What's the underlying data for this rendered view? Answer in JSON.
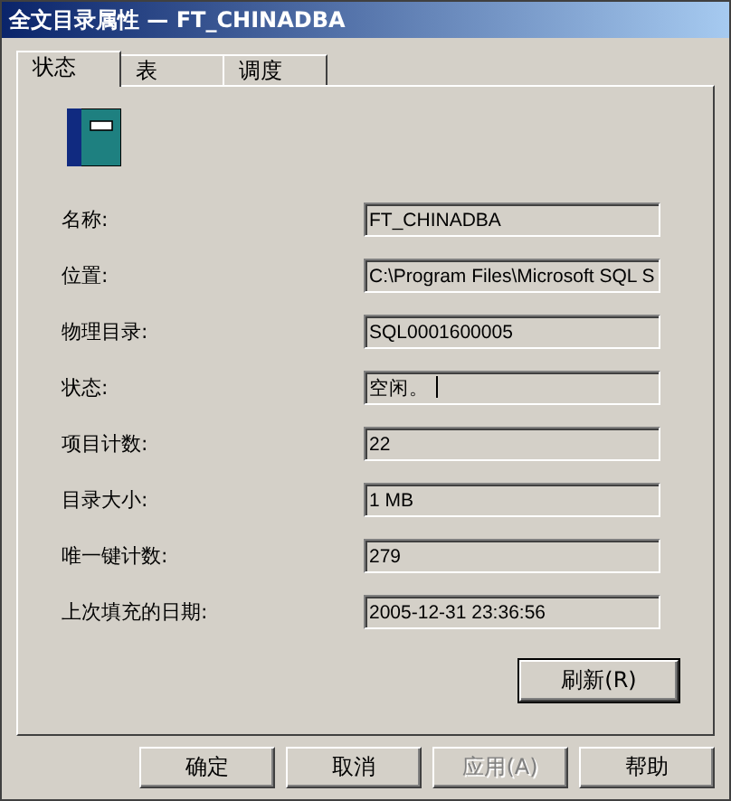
{
  "window": {
    "title": "全文目录属性 — FT_CHINADBA"
  },
  "tabs": [
    {
      "label": "状态",
      "selected": true
    },
    {
      "label": "表",
      "selected": false
    },
    {
      "label": "调度",
      "selected": false
    }
  ],
  "fields": [
    {
      "label": "名称:",
      "value": "FT_CHINADBA",
      "focused": false
    },
    {
      "label": "位置:",
      "value": "C:\\Program Files\\Microsoft SQL S",
      "focused": false
    },
    {
      "label": "物理目录:",
      "value": "SQL0001600005",
      "focused": false
    },
    {
      "label": "状态:",
      "value": "空闲。",
      "focused": true
    },
    {
      "label": "项目计数:",
      "value": "22",
      "focused": false
    },
    {
      "label": "目录大小:",
      "value": "1 MB",
      "focused": false
    },
    {
      "label": "唯一键计数:",
      "value": "279",
      "focused": false
    },
    {
      "label": "上次填充的日期:",
      "value": "2005-12-31 23:36:56",
      "focused": false
    }
  ],
  "refresh_button": "刷新(R)",
  "buttons": [
    {
      "label": "确定",
      "disabled": false
    },
    {
      "label": "取消",
      "disabled": false
    },
    {
      "label": "应用(A)",
      "disabled": true
    },
    {
      "label": "帮助",
      "disabled": false
    }
  ]
}
